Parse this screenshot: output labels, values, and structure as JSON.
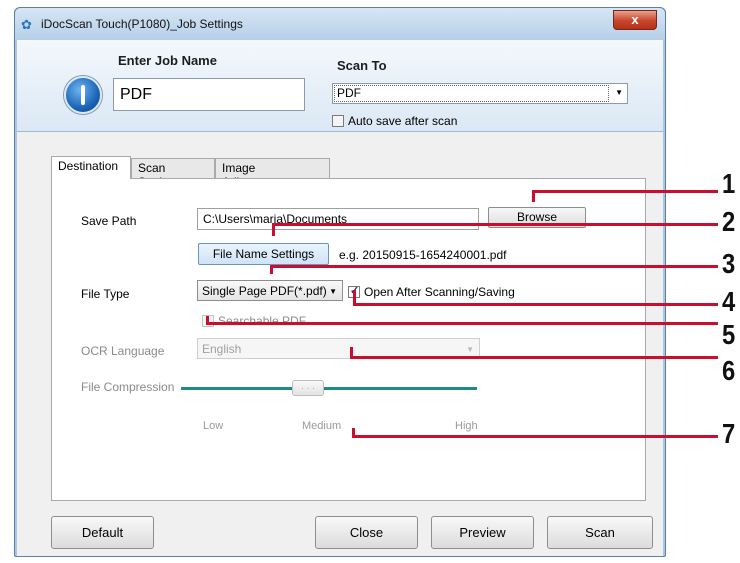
{
  "window": {
    "title": "iDocScan Touch(P1080)_Job Settings",
    "close_glyph": "x"
  },
  "header": {
    "job_name_label": "Enter Job Name",
    "job_name_value": "PDF",
    "scan_to_label": "Scan To",
    "scan_to_value": "PDF",
    "auto_save_label": "Auto save after scan",
    "auto_save_checked": false
  },
  "tabs": [
    {
      "label": "Destination",
      "active": true
    },
    {
      "label": "Scan Settings",
      "active": false
    },
    {
      "label": "Image Adjustments",
      "active": false
    }
  ],
  "destination": {
    "save_path_label": "Save Path",
    "save_path_value": "C:\\Users\\maria\\Documents",
    "browse_label": "Browse",
    "file_name_settings_label": "File Name Settings",
    "file_name_example": "e.g. 20150915-1654240001.pdf",
    "file_type_label": "File Type",
    "file_type_value": "Single Page PDF(*.pdf)",
    "open_after_label": "Open After Scanning/Saving",
    "open_after_checked": true,
    "searchable_pdf_label": "Searchable PDF",
    "searchable_pdf_checked": false,
    "ocr_language_label": "OCR Language",
    "ocr_language_value": "English",
    "file_compression_label": "File Compression",
    "compression_level": "Medium",
    "compression_ticks": [
      "Low",
      "Medium",
      "High"
    ]
  },
  "footer": {
    "default_label": "Default",
    "close_label": "Close",
    "preview_label": "Preview",
    "scan_label": "Scan"
  },
  "callouts": [
    "1",
    "2",
    "3",
    "4",
    "5",
    "6",
    "7"
  ],
  "colors": {
    "callout": "#c8102e",
    "slider": "#1d8c84",
    "title_bar": "#b5cfe8"
  }
}
